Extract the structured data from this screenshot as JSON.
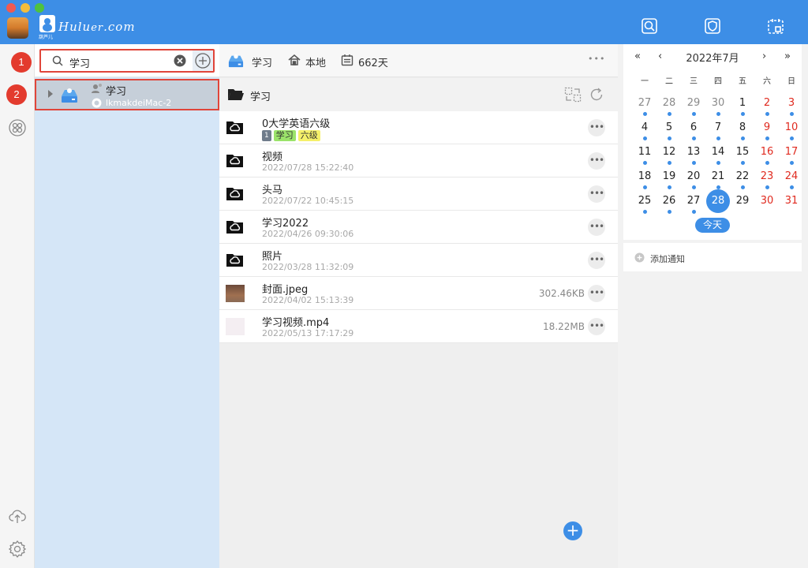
{
  "app": {
    "logo_text": "Hulu\u0000er.com",
    "logo_sub": "葫芦儿"
  },
  "search": {
    "value": "学习",
    "marker": "1"
  },
  "tree": {
    "marker": "2",
    "title": "学习",
    "subtitle": "lkmakdeiMac-2"
  },
  "header": {
    "library": "学习",
    "local": "本地",
    "days": "662天",
    "more": "•••"
  },
  "path": {
    "folder": "学习"
  },
  "files": [
    {
      "name": "0大学英语六级",
      "date": "",
      "size": "",
      "type": "folder",
      "badge": "1",
      "tags": [
        "学习",
        "六级"
      ]
    },
    {
      "name": "视频",
      "date": "2022/07/28 15:22:40",
      "size": "",
      "type": "folder"
    },
    {
      "name": "头马",
      "date": "2022/07/22 10:45:15",
      "size": "",
      "type": "folder"
    },
    {
      "name": "学习2022",
      "date": "2022/04/26 09:30:06",
      "size": "",
      "type": "folder"
    },
    {
      "name": "照片",
      "date": "2022/03/28 11:32:09",
      "size": "",
      "type": "folder"
    },
    {
      "name": "封面.jpeg",
      "date": "2022/04/02 15:13:39",
      "size": "302.46KB",
      "type": "image"
    },
    {
      "name": "学习视频.mp4",
      "date": "2022/05/13 17:17:29",
      "size": "18.22MB",
      "type": "video"
    }
  ],
  "more_label": "•••",
  "calendar": {
    "title": "2022年7月",
    "nav": {
      "prev_year": "«",
      "prev_month": "‹",
      "next_month": "›",
      "next_year": "»"
    },
    "weekdays": [
      "一",
      "二",
      "三",
      "四",
      "五",
      "六",
      "日"
    ],
    "weeks": [
      [
        "27",
        "28",
        "29",
        "30",
        "1",
        "2",
        "3"
      ],
      [
        "4",
        "5",
        "6",
        "7",
        "8",
        "9",
        "10"
      ],
      [
        "11",
        "12",
        "13",
        "14",
        "15",
        "16",
        "17"
      ],
      [
        "18",
        "19",
        "20",
        "21",
        "22",
        "23",
        "24"
      ],
      [
        "25",
        "26",
        "27",
        "28",
        "29",
        "30",
        "31"
      ]
    ],
    "selected": "28",
    "today_label": "今天"
  },
  "notify": {
    "label": "添加通知"
  },
  "colors": {
    "accent": "#3d8ee6",
    "highlight": "#e0453a",
    "tag_green": "#9be36a",
    "tag_yellow": "#f5f06a"
  }
}
